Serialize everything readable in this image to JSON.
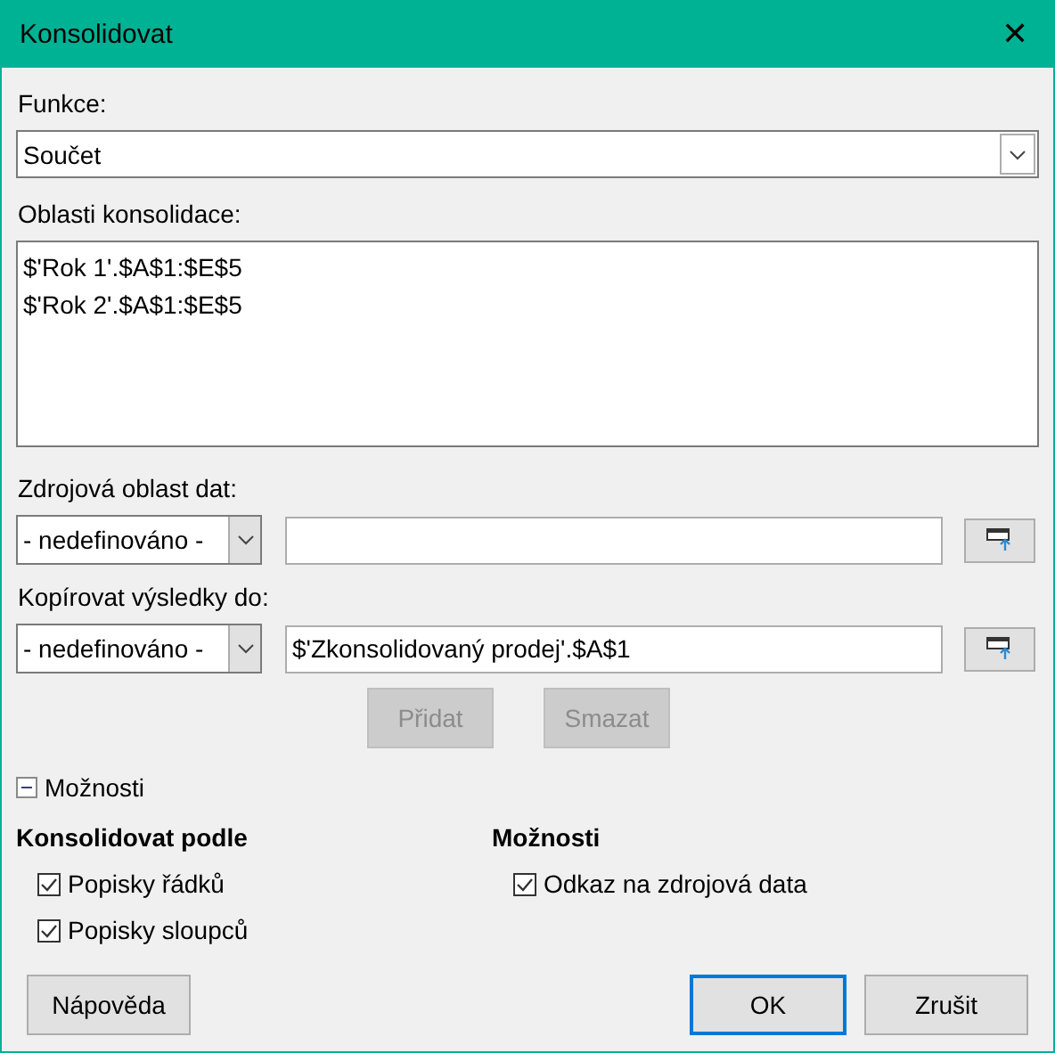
{
  "window": {
    "title": "Konsolidovat",
    "close": "✕"
  },
  "function": {
    "label": "Funkce:",
    "value": "Součet"
  },
  "consolidation_ranges": {
    "label": "Oblasti konsolidace:",
    "items": [
      {
        "text": "$'Rok 1'.$A$1:$E$5",
        "selected": false
      },
      {
        "text": "$'Rok 2'.$A$1:$E$5",
        "selected": false
      }
    ]
  },
  "source_range": {
    "label": "Zdrojová oblast dat:",
    "dropdown": "- nedefinováno -"
  },
  "copy_results_to": {
    "label": "Kopírovat výsledky do:",
    "dropdown": "- nedefinováno -",
    "value": "$'Zkonsolidovaný prodej'.$A$1"
  },
  "range_buttons": [
    {
      "label": "Přidat",
      "disabled": true
    },
    {
      "label": "Smazat",
      "disabled": true
    }
  ],
  "options_expander": {
    "label": "Možnosti",
    "expanded": true
  },
  "option_groups": [
    {
      "title": "Konsolidovat podle",
      "options": [
        {
          "label": "Popisky řádků",
          "checked": true
        },
        {
          "label": "Popisky sloupců",
          "checked": true
        }
      ]
    },
    {
      "title": "Možnosti",
      "options": [
        {
          "label": "Odkaz na zdrojová data",
          "checked": true
        }
      ]
    }
  ],
  "buttons": [
    {
      "label": "Nápověda",
      "kind": "help",
      "default": false
    },
    {
      "label": "OK",
      "kind": "action",
      "default": true
    },
    {
      "label": "Zrušit",
      "kind": "action",
      "default": false
    }
  ]
}
